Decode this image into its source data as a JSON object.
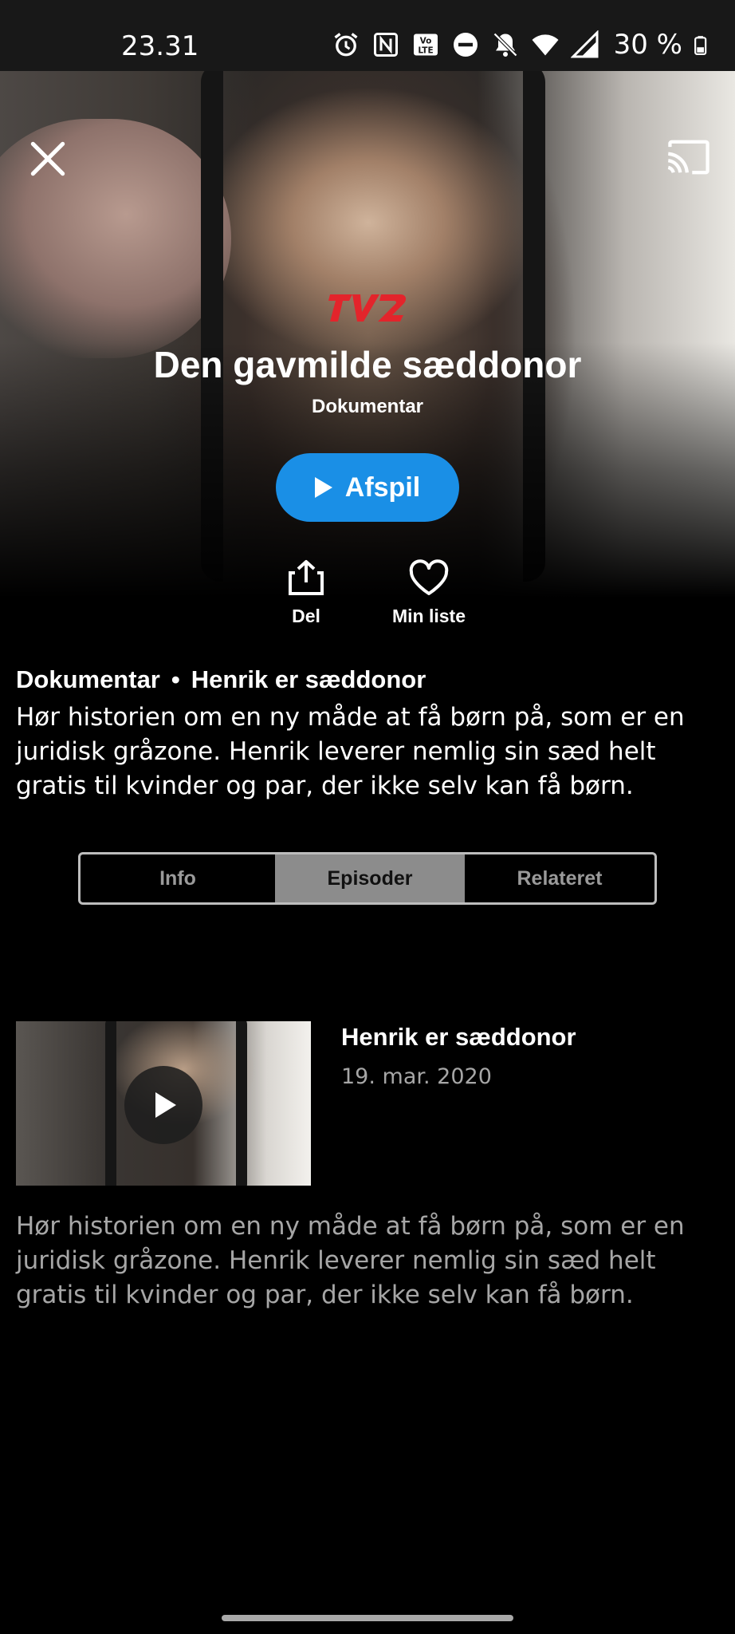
{
  "status_bar": {
    "time": "23.31",
    "battery": "30 %",
    "icons": [
      "alarm-icon",
      "nfc-icon",
      "volte-icon",
      "do-not-disturb-icon",
      "notifications-off-icon",
      "wifi-icon",
      "cell-signal-icon",
      "battery-icon"
    ]
  },
  "hero": {
    "channel_logo": "TV2",
    "title": "Den gavmilde sæddonor",
    "genre": "Dokumentar",
    "play_label": "Afspil"
  },
  "actions": {
    "share_label": "Del",
    "mylist_label": "Min liste"
  },
  "details": {
    "category": "Dokumentar",
    "separator": "•",
    "episode_name": "Henrik er sæddonor",
    "description": "Hør historien om en ny måde at få børn på, som er en juridisk gråzone. Henrik leverer nemlig sin sæd helt gratis til kvinder og par, der ikke selv kan få børn."
  },
  "tabs": [
    {
      "label": "Info",
      "selected": false
    },
    {
      "label": "Episoder",
      "selected": true
    },
    {
      "label": "Relateret",
      "selected": false
    }
  ],
  "episodes": [
    {
      "title": "Henrik er sæddonor",
      "date": "19. mar. 2020",
      "description": "Hør historien om en ny måde at få børn på, som er en juridisk gråzone. Henrik leverer nemlig sin sæd helt gratis til kvinder og par, der ikke selv kan få børn."
    }
  ],
  "colors": {
    "accent": "#1a8fe6",
    "logo_red": "#e3242b",
    "selected_tab_bg": "#8c8c8c"
  }
}
